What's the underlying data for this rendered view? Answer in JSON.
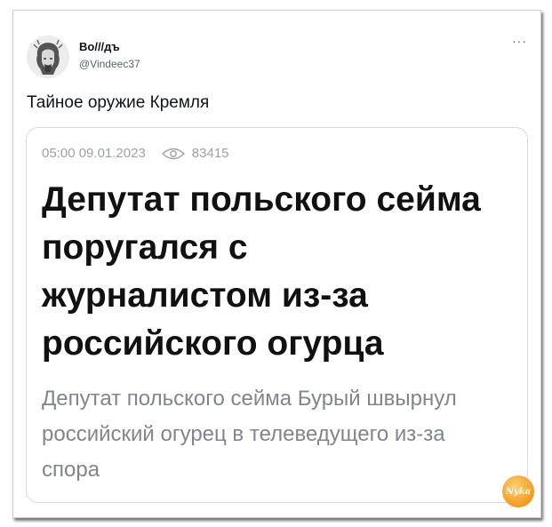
{
  "tweet": {
    "author_name": "Во///дъ",
    "author_handle": "@Vindeec37",
    "more_icon": "more-dots-icon",
    "text": "Тайное оружие Кремля"
  },
  "card": {
    "time": "05:00",
    "date": "09.01.2023",
    "views_icon": "eye-icon",
    "views": "83415",
    "headline": "Депутат польского сейма поругался с журналистом из-за российского огурца",
    "lede": "Депутат польского сейма Бурый швырнул российский огурец в телеведущего из-за спора"
  },
  "watermark": {
    "text": "Nyka"
  },
  "colors": {
    "text_primary": "#0f1419",
    "text_secondary": "#536471",
    "meta_gray": "#9aa1a8",
    "lede_gray": "#80868d",
    "border": "#d5dbe0",
    "watermark_orange": "#f39a1e"
  }
}
